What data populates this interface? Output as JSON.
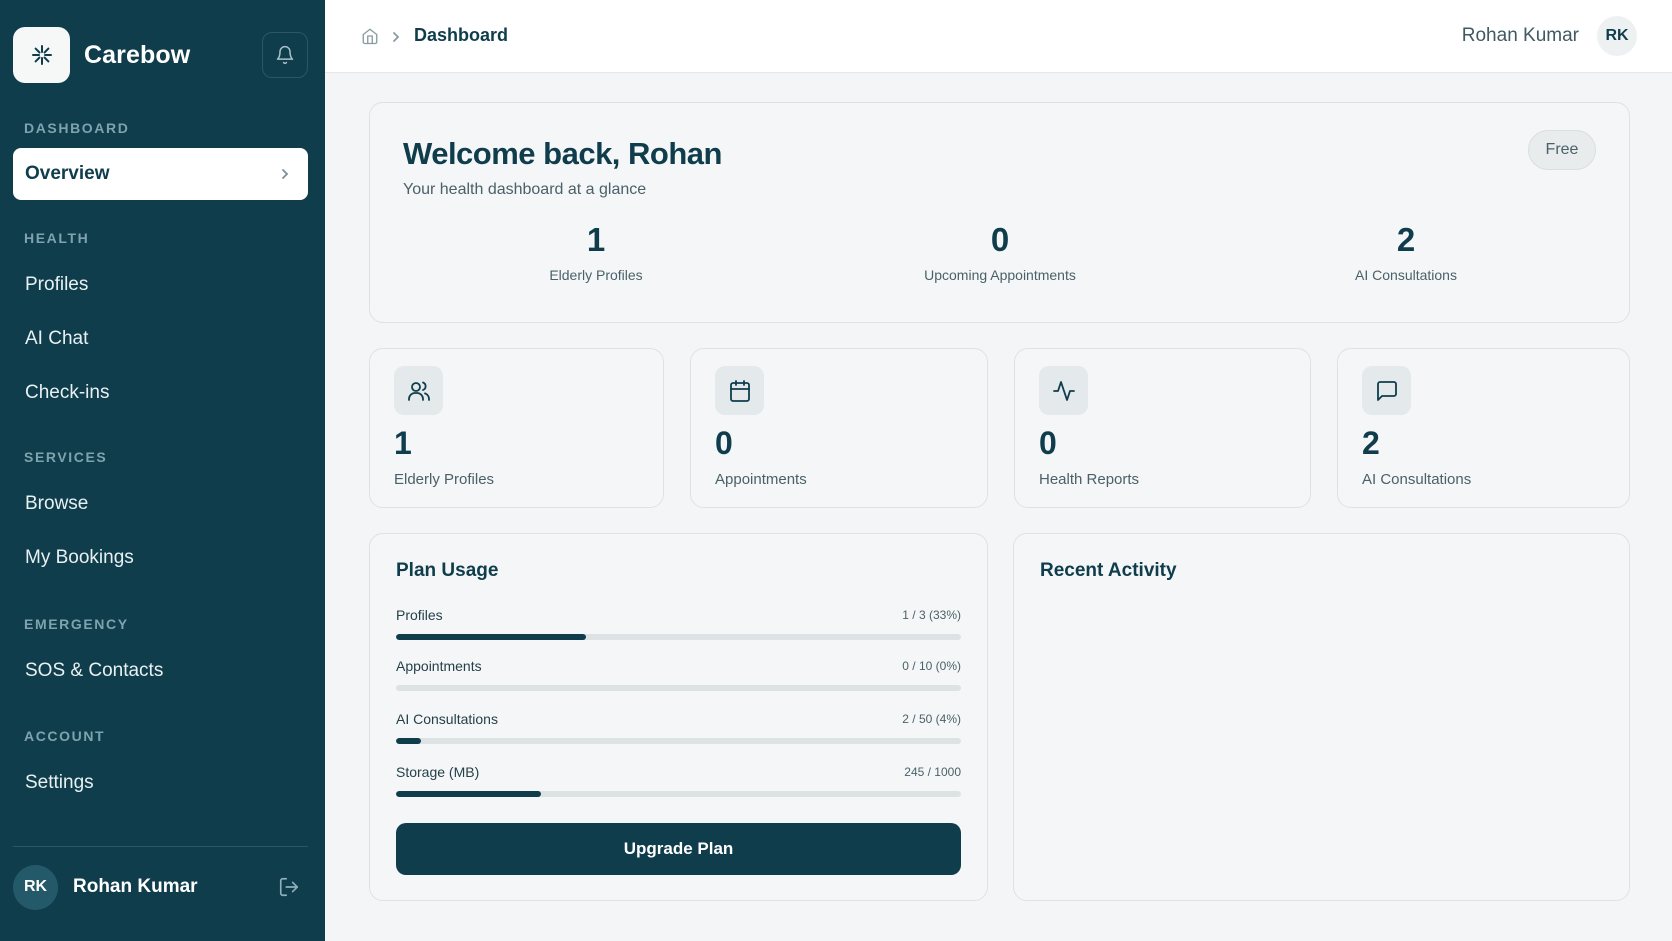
{
  "sidebar": {
    "brand": "Carebow",
    "sections": {
      "dashboard": "DASHBOARD",
      "health": "HEALTH",
      "services": "SERVICES",
      "emergency": "EMERGENCY",
      "account": "ACCOUNT"
    },
    "items": {
      "overview": "Overview",
      "profiles": "Profiles",
      "ai_chat": "AI Chat",
      "checkins": "Check-ins",
      "browse": "Browse",
      "bookings": "My Bookings",
      "sos": "SOS & Contacts",
      "settings": "Settings"
    },
    "user": {
      "initials": "RK",
      "name": "Rohan Kumar"
    }
  },
  "topbar": {
    "breadcrumb": "Dashboard",
    "user_name": "Rohan Kumar",
    "user_initials": "RK"
  },
  "welcome": {
    "title": "Welcome back, Rohan",
    "subtitle": "Your health dashboard at a glance",
    "plan": "Free",
    "stats": [
      {
        "value": "1",
        "label": "Elderly Profiles"
      },
      {
        "value": "0",
        "label": "Upcoming Appointments"
      },
      {
        "value": "2",
        "label": "AI Consultations"
      }
    ]
  },
  "stat_cards": [
    {
      "icon": "users-icon",
      "value": "1",
      "label": "Elderly Profiles"
    },
    {
      "icon": "calendar-icon",
      "value": "0",
      "label": "Appointments"
    },
    {
      "icon": "activity-icon",
      "value": "0",
      "label": "Health Reports"
    },
    {
      "icon": "message-icon",
      "value": "2",
      "label": "AI Consultations"
    }
  ],
  "plan_usage": {
    "title": "Plan Usage",
    "rows": [
      {
        "label": "Profiles",
        "value": "1 / 3 (33%)",
        "fraction": 0.336
      },
      {
        "label": "Appointments",
        "value": "0 / 10 (0%)",
        "fraction": 0
      },
      {
        "label": "AI Consultations",
        "value": "2 / 50 (4%)",
        "fraction": 0.045
      },
      {
        "label": "Storage (MB)",
        "value": "245 / 1000",
        "fraction": 0.257
      }
    ],
    "button": "Upgrade Plan"
  },
  "recent_activity": {
    "title": "Recent Activity"
  },
  "colors": {
    "primary": "#0f3d4c",
    "background": "#f3f5f6",
    "card": "#f5f6f7"
  }
}
